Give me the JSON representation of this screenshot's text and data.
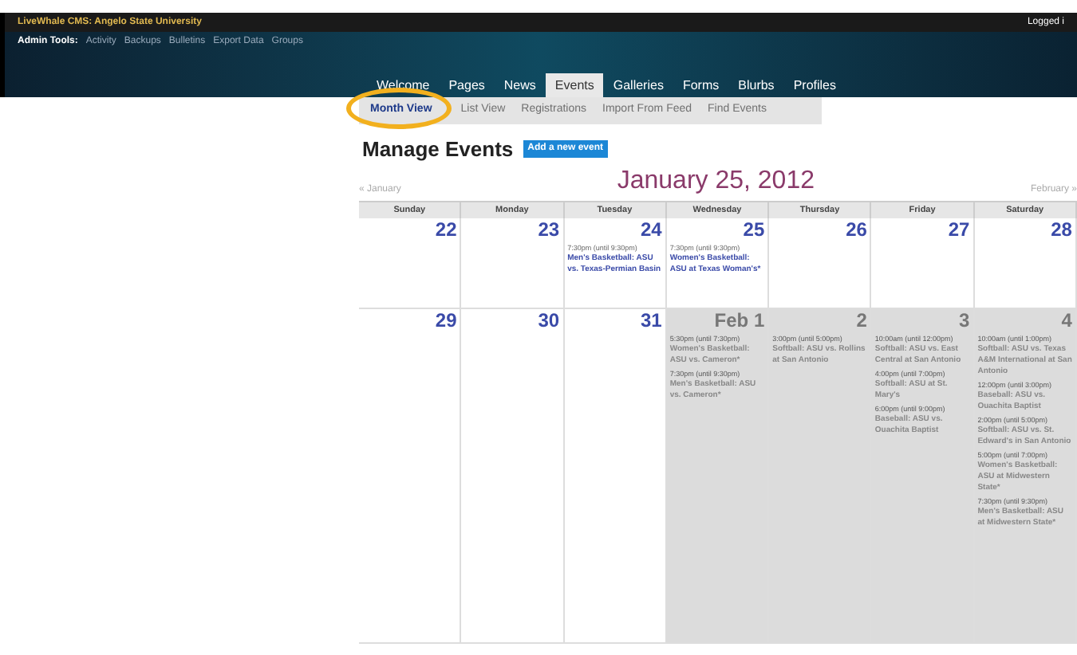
{
  "top_bar": {
    "site_title": "LiveWhale CMS: Angelo State University",
    "user_text": "Logged i"
  },
  "admin_tools": {
    "label": "Admin Tools:",
    "links": [
      "Activity",
      "Backups",
      "Bulletins",
      "Export Data",
      "Groups"
    ]
  },
  "tabs": [
    {
      "label": "Welcome",
      "selected": false
    },
    {
      "label": "Pages",
      "selected": false
    },
    {
      "label": "News",
      "selected": false
    },
    {
      "label": "Events",
      "selected": true
    },
    {
      "label": "Galleries",
      "selected": false
    },
    {
      "label": "Forms",
      "selected": false
    },
    {
      "label": "Blurbs",
      "selected": false
    },
    {
      "label": "Profiles",
      "selected": false
    }
  ],
  "subtabs": [
    {
      "label": "Month View",
      "selected": true,
      "circled": true
    },
    {
      "label": "List View",
      "selected": false,
      "circled": false
    },
    {
      "label": "Registrations",
      "selected": false,
      "circled": false
    },
    {
      "label": "Import From Feed",
      "selected": false,
      "circled": false
    },
    {
      "label": "Find Events",
      "selected": false,
      "circled": false
    }
  ],
  "heading": "Manage Events",
  "add_button": "Add a new event",
  "calendar": {
    "title": "January 25, 2012",
    "prev": "« January",
    "next": "February »",
    "weekdays": [
      "Sunday",
      "Monday",
      "Tuesday",
      "Wednesday",
      "Thursday",
      "Friday",
      "Saturday"
    ],
    "weeks": [
      [
        {
          "day": "22",
          "dimmed": false
        },
        {
          "day": "23",
          "dimmed": false
        },
        {
          "day": "24",
          "dimmed": false,
          "events": [
            {
              "time": "7:30pm (until 9:30pm)",
              "title": "Men's Basketball: ASU vs. Texas-Permian Basin"
            }
          ]
        },
        {
          "day": "25",
          "dimmed": false,
          "events": [
            {
              "time": "7:30pm (until 9:30pm)",
              "title": "Women's Basketball: ASU at Texas Woman's*"
            }
          ]
        },
        {
          "day": "26",
          "dimmed": false
        },
        {
          "day": "27",
          "dimmed": false
        },
        {
          "day": "28",
          "dimmed": false
        }
      ],
      [
        {
          "day": "29",
          "dimmed": false
        },
        {
          "day": "30",
          "dimmed": false
        },
        {
          "day": "31",
          "dimmed": false
        },
        {
          "day": "Feb 1",
          "dimmed": true,
          "events": [
            {
              "time": "5:30pm (until 7:30pm)",
              "title": "Women's Basketball: ASU vs. Cameron*"
            },
            {
              "time": "7:30pm (until 9:30pm)",
              "title": "Men's Basketball: ASU vs. Cameron*"
            }
          ]
        },
        {
          "day": "2",
          "dimmed": true,
          "events": [
            {
              "time": "3:00pm (until 5:00pm)",
              "title": "Softball: ASU vs. Rollins at San Antonio"
            }
          ]
        },
        {
          "day": "3",
          "dimmed": true,
          "events": [
            {
              "time": "10:00am (until 12:00pm)",
              "title": "Softball: ASU vs. East Central at San Antonio"
            },
            {
              "time": "4:00pm (until 7:00pm)",
              "title": "Softball: ASU at St. Mary's"
            },
            {
              "time": "6:00pm (until 9:00pm)",
              "title": "Baseball: ASU vs. Ouachita Baptist"
            }
          ]
        },
        {
          "day": "4",
          "dimmed": true,
          "events": [
            {
              "time": "10:00am (until 1:00pm)",
              "title": "Softball: ASU vs. Texas A&M International at San Antonio"
            },
            {
              "time": "12:00pm (until 3:00pm)",
              "title": "Baseball: ASU vs. Ouachita Baptist"
            },
            {
              "time": "2:00pm (until 5:00pm)",
              "title": "Softball: ASU vs. St. Edward's in San Antonio"
            },
            {
              "time": "5:00pm (until 7:00pm)",
              "title": "Women's Basketball: ASU at Midwestern State*"
            },
            {
              "time": "7:30pm (until 9:30pm)",
              "title": "Men's Basketball: ASU at Midwestern State*"
            }
          ]
        }
      ]
    ]
  }
}
